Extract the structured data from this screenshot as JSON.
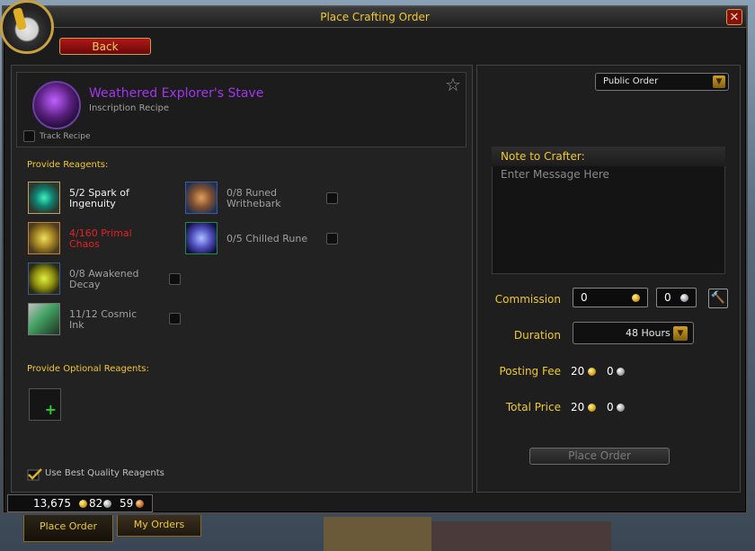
{
  "window": {
    "title": "Place Crafting Order",
    "close_label": "✕"
  },
  "back_label": "Back",
  "recipe": {
    "name": "Weathered Explorer's Stave",
    "subtitle": "Inscription Recipe",
    "track_label": "Track Recipe",
    "favorite_icon": "star-icon"
  },
  "reagents": {
    "heading": "Provide Reagents:",
    "items": [
      {
        "line1": "5/2 Spark of",
        "line2": "Ingenuity",
        "state": "met",
        "color": "#2ad0a0"
      },
      {
        "line1": "4/160 Primal",
        "line2": "Chaos",
        "state": "missing",
        "color": "#e0c040"
      },
      {
        "line1": "0/8 Awakened",
        "line2": "Decay",
        "state": "optional",
        "color": "#b0c020"
      },
      {
        "line1": "11/12 Cosmic",
        "line2": "Ink",
        "state": "optional",
        "color": "#40a060"
      },
      {
        "line1": "0/8 Runed",
        "line2": "Writhebark",
        "state": "optional",
        "color": "#c08040"
      },
      {
        "line1": "0/5 Chilled Rune",
        "line2": "",
        "state": "optional",
        "color": "#6070e0"
      }
    ]
  },
  "optional_reagents": {
    "heading": "Provide Optional Reagents:"
  },
  "best_quality_label": "Use Best Quality Reagents",
  "order_type": {
    "selected": "Public Order"
  },
  "note": {
    "title": "Note to Crafter:",
    "placeholder": "Enter Message Here"
  },
  "commission": {
    "label": "Commission",
    "gold": "0",
    "silver": "0"
  },
  "duration": {
    "label": "Duration",
    "selected": "48 Hours"
  },
  "posting_fee": {
    "label": "Posting Fee",
    "gold": "20",
    "silver": "0"
  },
  "total_price": {
    "label": "Total Price",
    "gold": "20",
    "silver": "0"
  },
  "place_order_label": "Place Order",
  "wallet": {
    "gold": "13,675",
    "silver": "82",
    "copper": "59"
  },
  "tabs": [
    {
      "label": "Place Order",
      "active": true
    },
    {
      "label": "My Orders",
      "active": false
    }
  ]
}
